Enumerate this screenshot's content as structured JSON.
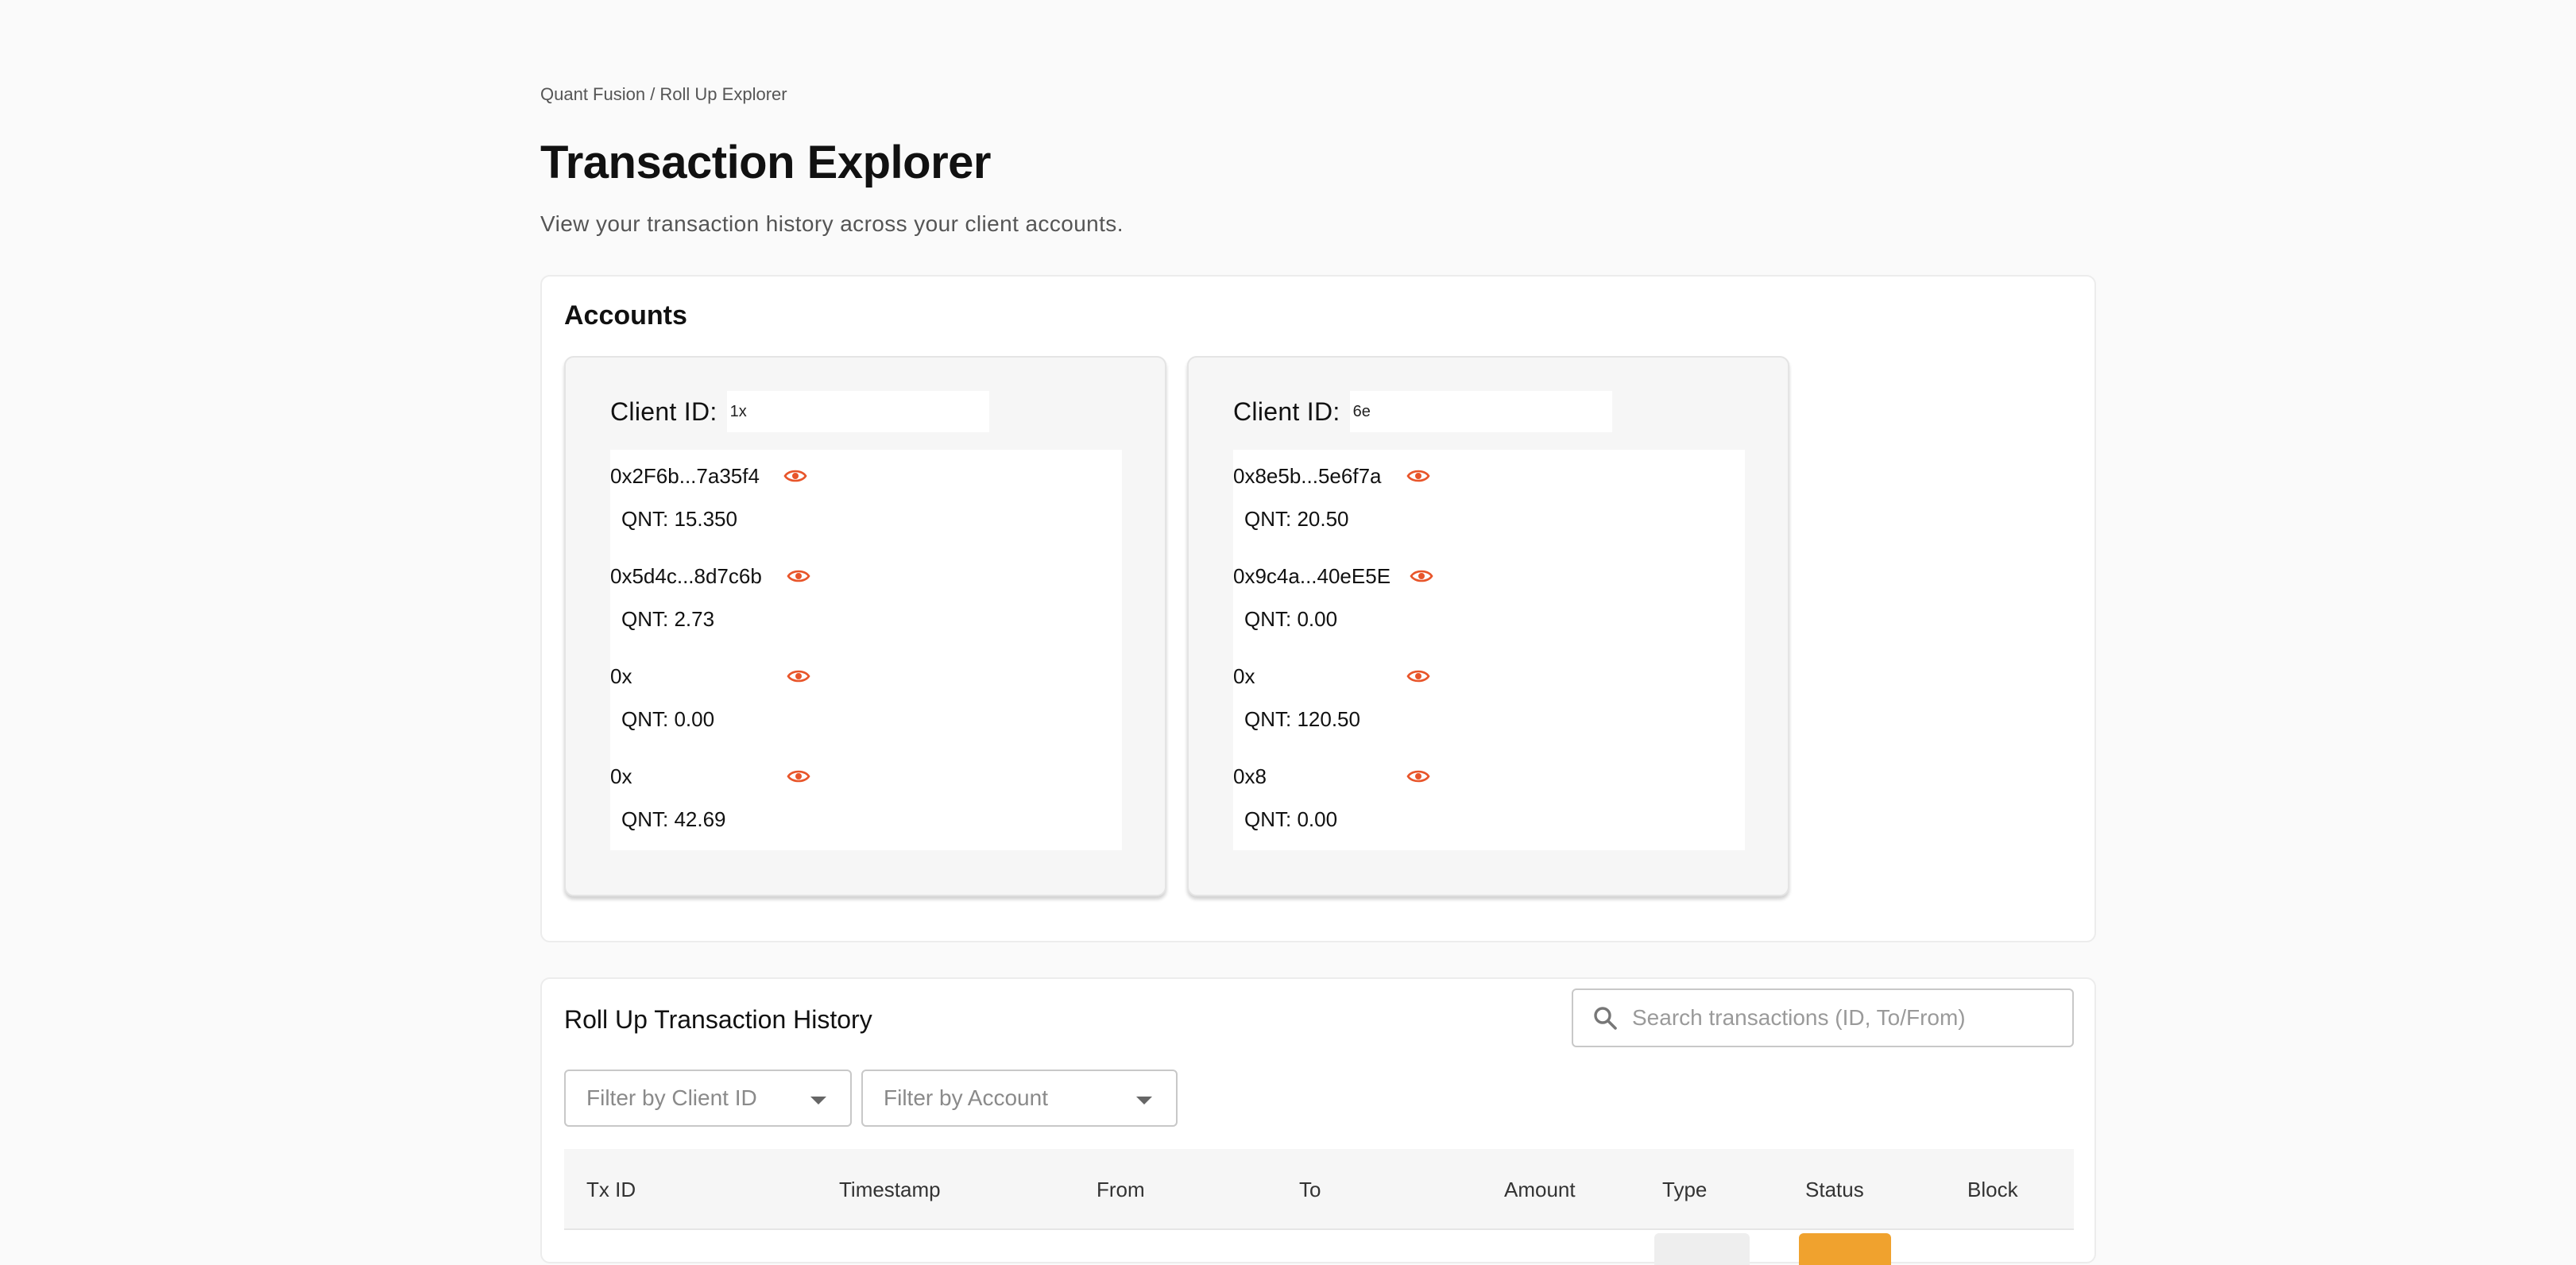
{
  "breadcrumb": "Quant Fusion / Roll Up Explorer",
  "title": "Transaction Explorer",
  "subtitle": "View your transaction history across your client accounts.",
  "colors": {
    "accent": "#e8552a",
    "status_pending": "#f0a22e"
  },
  "accounts": {
    "title": "Accounts",
    "clients": [
      {
        "label": "Client ID:",
        "id": "1x",
        "accounts": [
          {
            "address": "0x2F6b...7a35f4",
            "balance": "QNT: 15.350",
            "icon": "eye-icon"
          },
          {
            "address": "0x5d4c...8d7c6b",
            "balance": "QNT: 2.73",
            "icon": "eye-icon"
          },
          {
            "address": "0x",
            "balance": "QNT: 0.00",
            "icon": "eye-icon"
          },
          {
            "address": "0x",
            "balance": "QNT: 42.69",
            "icon": "eye-icon"
          }
        ]
      },
      {
        "label": "Client ID:",
        "id": "6e",
        "accounts": [
          {
            "address": "0x8e5b...5e6f7a",
            "balance": "QNT: 20.50",
            "icon": "eye-icon"
          },
          {
            "address": "0x9c4a...40eE5E",
            "balance": "QNT: 0.00",
            "icon": "eye-icon"
          },
          {
            "address": "0x",
            "balance": "QNT: 120.50",
            "icon": "eye-icon"
          },
          {
            "address": "0x8",
            "balance": "QNT: 0.00",
            "icon": "eye-icon"
          }
        ]
      }
    ]
  },
  "history": {
    "title": "Roll Up Transaction History",
    "search_placeholder": "Search transactions (ID, To/From)",
    "filters": {
      "client": "Filter by Client ID",
      "account": "Filter by Account"
    },
    "columns": [
      "Tx ID",
      "Timestamp",
      "From",
      "To",
      "Amount",
      "Type",
      "Status",
      "Block"
    ]
  }
}
